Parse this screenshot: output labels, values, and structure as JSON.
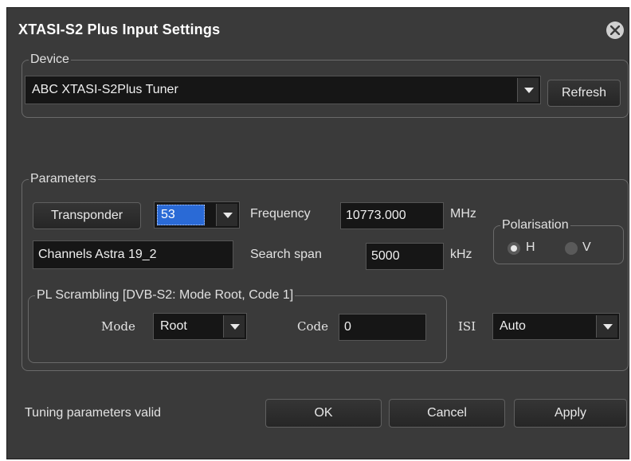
{
  "window": {
    "title": "XTASI-S2 Plus Input Settings"
  },
  "device": {
    "legend": "Device",
    "selected": "ABC XTASI-S2Plus Tuner",
    "refresh_label": "Refresh"
  },
  "parameters": {
    "legend": "Parameters",
    "transponder_label": "Transponder",
    "transponder_value": "53",
    "transponder_name": "Channels Astra 19_2",
    "frequency_label": "Frequency",
    "frequency_value": "10773.000",
    "frequency_unit": "MHz",
    "search_span_label": "Search span",
    "search_span_value": "5000",
    "search_span_unit": "kHz",
    "polarisation": {
      "legend": "Polarisation",
      "h_label": "H",
      "v_label": "V",
      "selected": "H"
    },
    "pl_scrambling": {
      "legend": "PL Scrambling  [DVB-S2: Mode Root, Code 1]",
      "mode_label": "Mode",
      "mode_value": "Root",
      "code_label": "Code",
      "code_value": "0"
    },
    "isi_label": "ISI",
    "isi_value": "Auto"
  },
  "footer": {
    "status": "Tuning parameters valid",
    "ok_label": "OK",
    "cancel_label": "Cancel",
    "apply_label": "Apply"
  }
}
